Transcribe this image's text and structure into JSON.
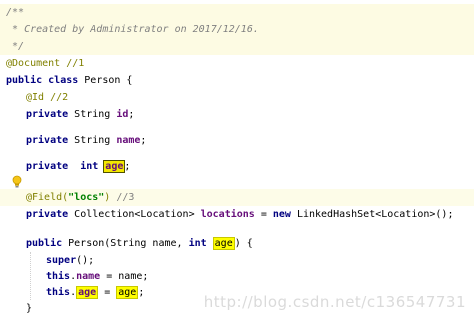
{
  "code": {
    "c_open": "/**",
    "c_created_prefix": " * ",
    "c_created_text": "Created by Administrator on 2017/12/16.",
    "c_close": " */",
    "l_document": "@Document //1",
    "l_class_public": "public",
    "l_class_class": "class",
    "l_class_name": " Person {",
    "l_id_anno": "@Id //2",
    "l_id_private": "private",
    "l_id_type": " String ",
    "l_id_field": "id",
    "l_id_end": ";",
    "l_name_private": "private",
    "l_name_type": " String ",
    "l_name_field": "name",
    "l_name_end": ";",
    "l_age_private": "private",
    "l_age_int": "int",
    "l_age_field": "age",
    "l_age_end": ";",
    "l_field_anno": "@Field(",
    "l_field_str": "\"locs\"",
    "l_field_close": ")",
    "l_field_comment": " //3",
    "l_locs_private": "private",
    "l_locs_type": " Collection<Location> ",
    "l_locs_field": "locations",
    "l_locs_eq": " = ",
    "l_locs_new": "new",
    "l_locs_rest": " LinkedHashSet<Location>();",
    "l_ctor_public": "public",
    "l_ctor_sig": " Person(String name, ",
    "l_ctor_int": "int",
    "l_ctor_age": "age",
    "l_ctor_end": ") {",
    "l_super_kw": "super",
    "l_super_end": "();",
    "l_this1_kw": "this",
    "l_this1_dot": ".",
    "l_this1_field": "name",
    "l_this1_rest": " = name;",
    "l_this2_kw": "this",
    "l_this2_dot": ".",
    "l_this2_field": "age",
    "l_this2_eq": " = ",
    "l_this2_param": "age",
    "l_this2_end": ";",
    "l_close": "}"
  },
  "watermark": "http://blog.csdn.net/c136547731",
  "icons": {
    "gutter": "lightbulb-icon"
  }
}
